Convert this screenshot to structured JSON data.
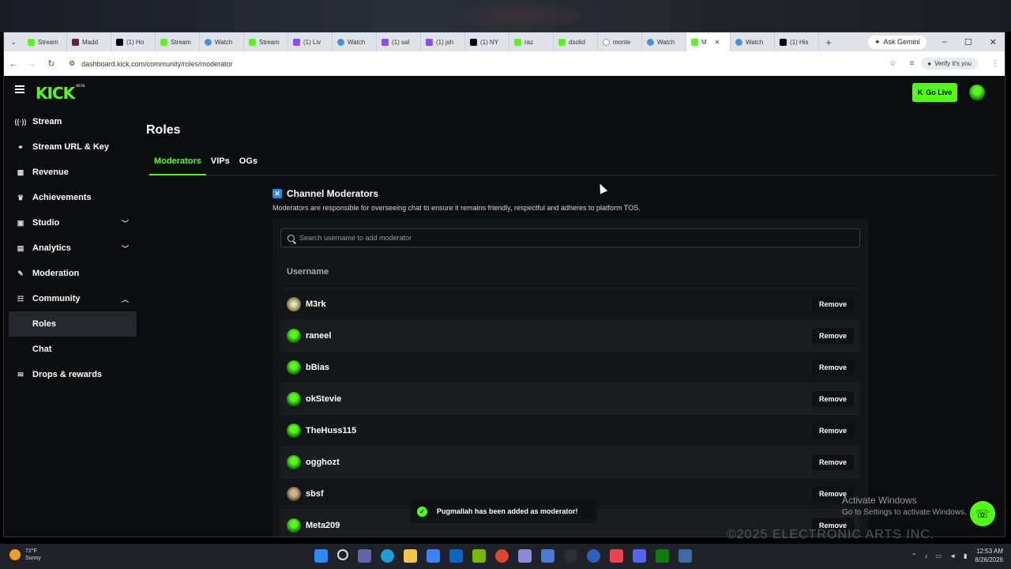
{
  "browser": {
    "tabs": [
      {
        "icon": "kick",
        "label": "Stream"
      },
      {
        "icon": "maddie",
        "label": "Madd"
      },
      {
        "icon": "x",
        "label": "(1) Ho"
      },
      {
        "icon": "kick",
        "label": "Stream"
      },
      {
        "icon": "watch",
        "label": "Watch"
      },
      {
        "icon": "kick",
        "label": "Stream"
      },
      {
        "icon": "twitch",
        "label": "(1) Liv"
      },
      {
        "icon": "watch",
        "label": "Watch"
      },
      {
        "icon": "twitch",
        "label": "(1) sal"
      },
      {
        "icon": "twitch",
        "label": "(1) jsh"
      },
      {
        "icon": "x",
        "label": "(1) NY"
      },
      {
        "icon": "kick",
        "label": "raz"
      },
      {
        "icon": "kick",
        "label": "dsolid"
      },
      {
        "icon": "google",
        "label": "monte"
      },
      {
        "icon": "watch",
        "label": "Watch"
      },
      {
        "icon": "kick",
        "label": "M"
      },
      {
        "icon": "watch",
        "label": "Watch"
      },
      {
        "icon": "x",
        "label": "(1) His"
      }
    ],
    "active_tab_index": 15,
    "ask_gemini": "Ask Gemini",
    "url": "dashboard.kick.com/community/roles/moderator",
    "verify": "Verify it's you"
  },
  "header": {
    "logo": "KICK",
    "logo_badge": "BETA",
    "go_live": "Go Live"
  },
  "sidebar": {
    "items": [
      {
        "label": "Stream",
        "icon": "stream-icon"
      },
      {
        "label": "Stream URL & Key",
        "icon": "link-icon"
      },
      {
        "label": "Revenue",
        "icon": "revenue-icon"
      },
      {
        "label": "Achievements",
        "icon": "trophy-icon"
      },
      {
        "label": "Studio",
        "icon": "studio-icon",
        "expand": "down"
      },
      {
        "label": "Analytics",
        "icon": "analytics-icon",
        "expand": "down"
      },
      {
        "label": "Moderation",
        "icon": "wrench-icon"
      },
      {
        "label": "Community",
        "icon": "community-icon",
        "expand": "up"
      },
      {
        "label": "Roles",
        "sub": true,
        "active": true
      },
      {
        "label": "Chat",
        "sub": true
      },
      {
        "label": "Drops & rewards",
        "icon": "gift-icon"
      }
    ]
  },
  "main": {
    "title": "Roles",
    "tabs": [
      "Moderators",
      "VIPs",
      "OGs"
    ],
    "active_tab": "Moderators",
    "section_title": "Channel Moderators",
    "section_desc": "Moderators are responsible for overseeing chat to ensure it remains friendly, respectful and adheres to platform TOS.",
    "search_placeholder": "Search username to add moderator",
    "col_username": "Username",
    "remove_label": "Remove",
    "moderators": [
      {
        "name": "M3rk",
        "avatar": "m3"
      },
      {
        "name": "raneel",
        "avatar": "kick"
      },
      {
        "name": "bBias",
        "avatar": "kick"
      },
      {
        "name": "okStevie",
        "avatar": "kick"
      },
      {
        "name": "TheHuss115",
        "avatar": "kick"
      },
      {
        "name": "ogghozt",
        "avatar": "kick"
      },
      {
        "name": "sbsf",
        "avatar": "face"
      },
      {
        "name": "Meta209",
        "avatar": "kick"
      }
    ]
  },
  "toast": "Pugmallah has been added as moderator!",
  "overlay": {
    "activate_title": "Activate Windows",
    "activate_sub": "Go to Settings to activate Windows.",
    "bg_text": "©2025 ELECTRONIC ARTS INC."
  },
  "taskbar": {
    "temp": "72°F",
    "weather": "Sunny",
    "time": "12:53 AM",
    "date": "8/26/2026"
  }
}
